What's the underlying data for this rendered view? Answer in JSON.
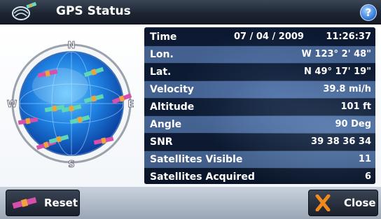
{
  "window": {
    "title": "GPS Status",
    "help_label": "?"
  },
  "compass": {
    "north": "N",
    "south": "S",
    "east": "E",
    "west": "W"
  },
  "info": {
    "time_label": "Time",
    "date": "07 / 04 / 2009",
    "time": "11:26:37",
    "rows": [
      {
        "label": "Lon.",
        "value": "W 123° 2' 48\""
      },
      {
        "label": "Lat.",
        "value": "N 49° 17' 19\""
      },
      {
        "label": "Velocity",
        "value": "39.8 mi/h"
      },
      {
        "label": "Altitude",
        "value": "101 ft"
      },
      {
        "label": "Angle",
        "value": "90 Deg"
      },
      {
        "label": "SNR",
        "value": "39 38 36 34"
      },
      {
        "label": "Satellites Visible",
        "value": "11"
      },
      {
        "label": "Satellites Acquired",
        "value": "6"
      }
    ]
  },
  "buttons": {
    "reset": "Reset",
    "close": "Close"
  },
  "colors": {
    "satellite_green": "#5fd6b4",
    "satellite_pink": "#d64fa8",
    "satellite_orange": "#f0a33a",
    "close_x": "#f08a1c"
  }
}
